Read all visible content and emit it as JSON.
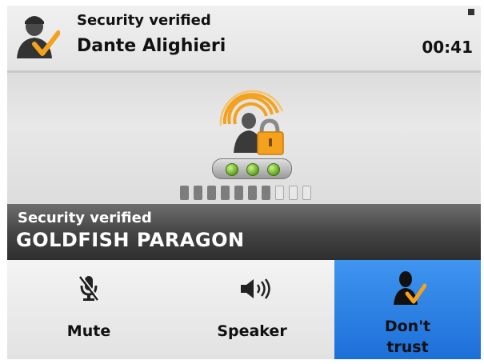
{
  "header": {
    "status_text": "Security verified",
    "contact_name": "Dante Alighieri",
    "call_timer": "00:41"
  },
  "security": {
    "strength_indicator_count": 3,
    "level_bar": {
      "filled": 7,
      "total": 10
    }
  },
  "banner": {
    "status_text": "Security verified",
    "verification_phrase": "GOLDFISH PARAGON"
  },
  "buttons": {
    "mute_label": "Mute",
    "speaker_label": "Speaker",
    "dont_trust_label": "Don't\ntrust"
  },
  "colors": {
    "accent_blue": "#2a7fe6",
    "check_orange": "#f4a21d",
    "indicator_green": "#6fbf2a",
    "banner_dark": "#3a3a3a"
  },
  "icons": {
    "avatar": "verified-user-icon",
    "expand": "expand-icon",
    "security": "secure-call-lock-icon",
    "mute": "microphone-muted-icon",
    "speaker": "speaker-icon",
    "dont_trust": "user-untrust-icon"
  }
}
